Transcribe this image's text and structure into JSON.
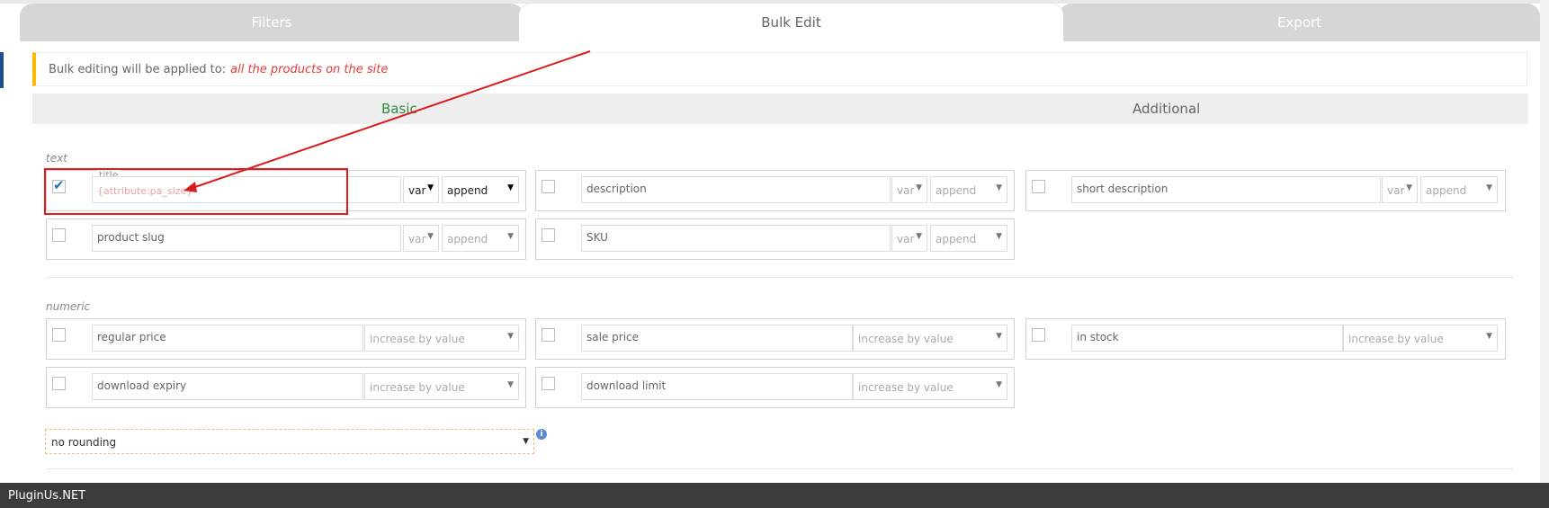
{
  "tabs": {
    "filters": "Filters",
    "bulk_edit": "Bulk Edit",
    "export": "Export"
  },
  "notice": {
    "prefix": "Bulk editing will be applied to:",
    "target": "all the products on the site"
  },
  "subtabs": {
    "basic": "Basic",
    "additional": "Additional"
  },
  "sections": {
    "text": "text",
    "numeric": "numeric"
  },
  "fields": {
    "title": {
      "label": "title",
      "value": "{attribute:pa_size}",
      "var": "var",
      "mode": "append",
      "checked": true
    },
    "description": {
      "placeholder": "description",
      "var": "var",
      "mode": "append"
    },
    "short_description": {
      "placeholder": "short description",
      "var": "var",
      "mode": "append"
    },
    "product_slug": {
      "placeholder": "product slug",
      "var": "var",
      "mode": "append"
    },
    "sku": {
      "placeholder": "SKU",
      "var": "var",
      "mode": "append"
    },
    "regular_price": {
      "placeholder": "regular price",
      "mode": "increase by value"
    },
    "sale_price": {
      "placeholder": "sale price",
      "mode": "increase by value"
    },
    "in_stock": {
      "placeholder": "in stock",
      "mode": "increase by value"
    },
    "download_expiry": {
      "placeholder": "download expiry",
      "mode": "increase by value"
    },
    "download_limit": {
      "placeholder": "download limit",
      "mode": "increase by value"
    }
  },
  "rounding": {
    "value": "no rounding"
  },
  "info_icon": "info-icon",
  "footer": {
    "brand": "PluginUs.NET"
  },
  "colors": {
    "accent_red": "#e31b1b",
    "notice_border": "#ffb900",
    "basic_green": "#2e8b3d",
    "checkbox_blue": "#2271b1"
  }
}
